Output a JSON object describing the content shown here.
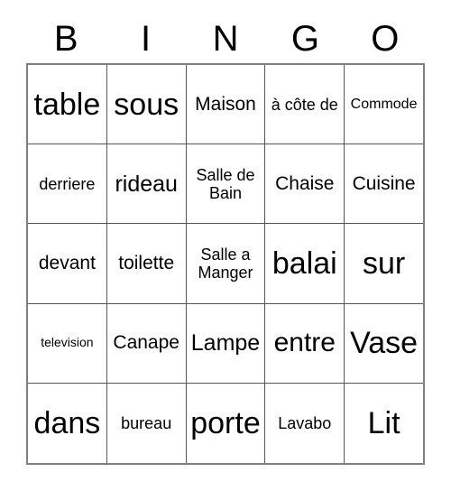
{
  "header": {
    "letters": [
      "B",
      "I",
      "N",
      "G",
      "O"
    ]
  },
  "grid": {
    "rows": [
      [
        {
          "text": "table",
          "size": "fs-xxl"
        },
        {
          "text": "sous",
          "size": "fs-xxl"
        },
        {
          "text": "Maison",
          "size": "fs-md"
        },
        {
          "text": "à côte de",
          "size": "fs-sm"
        },
        {
          "text": "Commode",
          "size": "fs-xs"
        }
      ],
      [
        {
          "text": "derriere",
          "size": "fs-sm"
        },
        {
          "text": "rideau",
          "size": "fs-lg"
        },
        {
          "text": "Salle de Bain",
          "size": "fs-sm"
        },
        {
          "text": "Chaise",
          "size": "fs-md"
        },
        {
          "text": "Cuisine",
          "size": "fs-md"
        }
      ],
      [
        {
          "text": "devant",
          "size": "fs-md"
        },
        {
          "text": "toilette",
          "size": "fs-md"
        },
        {
          "text": "Salle a Manger",
          "size": "fs-sm"
        },
        {
          "text": "balai",
          "size": "fs-xxl"
        },
        {
          "text": "sur",
          "size": "fs-xxl"
        }
      ],
      [
        {
          "text": "television",
          "size": "fs-xxs"
        },
        {
          "text": "Canape",
          "size": "fs-md"
        },
        {
          "text": "Lampe",
          "size": "fs-lg"
        },
        {
          "text": "entre",
          "size": "fs-xl"
        },
        {
          "text": "Vase",
          "size": "fs-xxl"
        }
      ],
      [
        {
          "text": "dans",
          "size": "fs-xxl"
        },
        {
          "text": "bureau",
          "size": "fs-sm"
        },
        {
          "text": "porte",
          "size": "fs-xxl"
        },
        {
          "text": "Lavabo",
          "size": "fs-sm"
        },
        {
          "text": "Lit",
          "size": "fs-xxl"
        }
      ]
    ]
  },
  "colors": {
    "background": "#ffffff",
    "text": "#000000",
    "inner_border": "#555555",
    "outer_border": "#808080"
  }
}
